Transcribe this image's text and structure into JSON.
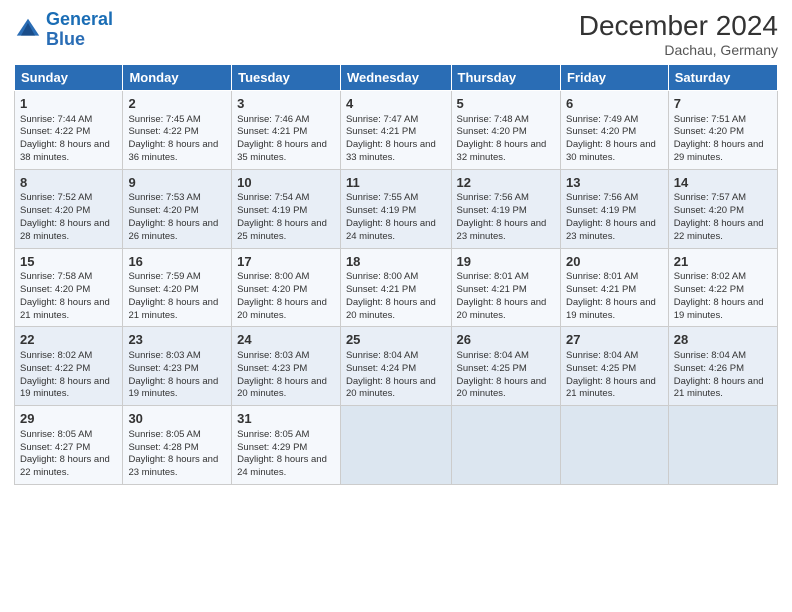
{
  "logo": {
    "line1": "General",
    "line2": "Blue"
  },
  "title": "December 2024",
  "location": "Dachau, Germany",
  "days_of_week": [
    "Sunday",
    "Monday",
    "Tuesday",
    "Wednesday",
    "Thursday",
    "Friday",
    "Saturday"
  ],
  "weeks": [
    [
      {
        "day": "1",
        "info": "Sunrise: 7:44 AM\nSunset: 4:22 PM\nDaylight: 8 hours and 38 minutes."
      },
      {
        "day": "2",
        "info": "Sunrise: 7:45 AM\nSunset: 4:22 PM\nDaylight: 8 hours and 36 minutes."
      },
      {
        "day": "3",
        "info": "Sunrise: 7:46 AM\nSunset: 4:21 PM\nDaylight: 8 hours and 35 minutes."
      },
      {
        "day": "4",
        "info": "Sunrise: 7:47 AM\nSunset: 4:21 PM\nDaylight: 8 hours and 33 minutes."
      },
      {
        "day": "5",
        "info": "Sunrise: 7:48 AM\nSunset: 4:20 PM\nDaylight: 8 hours and 32 minutes."
      },
      {
        "day": "6",
        "info": "Sunrise: 7:49 AM\nSunset: 4:20 PM\nDaylight: 8 hours and 30 minutes."
      },
      {
        "day": "7",
        "info": "Sunrise: 7:51 AM\nSunset: 4:20 PM\nDaylight: 8 hours and 29 minutes."
      }
    ],
    [
      {
        "day": "8",
        "info": "Sunrise: 7:52 AM\nSunset: 4:20 PM\nDaylight: 8 hours and 28 minutes."
      },
      {
        "day": "9",
        "info": "Sunrise: 7:53 AM\nSunset: 4:20 PM\nDaylight: 8 hours and 26 minutes."
      },
      {
        "day": "10",
        "info": "Sunrise: 7:54 AM\nSunset: 4:19 PM\nDaylight: 8 hours and 25 minutes."
      },
      {
        "day": "11",
        "info": "Sunrise: 7:55 AM\nSunset: 4:19 PM\nDaylight: 8 hours and 24 minutes."
      },
      {
        "day": "12",
        "info": "Sunrise: 7:56 AM\nSunset: 4:19 PM\nDaylight: 8 hours and 23 minutes."
      },
      {
        "day": "13",
        "info": "Sunrise: 7:56 AM\nSunset: 4:19 PM\nDaylight: 8 hours and 23 minutes."
      },
      {
        "day": "14",
        "info": "Sunrise: 7:57 AM\nSunset: 4:20 PM\nDaylight: 8 hours and 22 minutes."
      }
    ],
    [
      {
        "day": "15",
        "info": "Sunrise: 7:58 AM\nSunset: 4:20 PM\nDaylight: 8 hours and 21 minutes."
      },
      {
        "day": "16",
        "info": "Sunrise: 7:59 AM\nSunset: 4:20 PM\nDaylight: 8 hours and 21 minutes."
      },
      {
        "day": "17",
        "info": "Sunrise: 8:00 AM\nSunset: 4:20 PM\nDaylight: 8 hours and 20 minutes."
      },
      {
        "day": "18",
        "info": "Sunrise: 8:00 AM\nSunset: 4:21 PM\nDaylight: 8 hours and 20 minutes."
      },
      {
        "day": "19",
        "info": "Sunrise: 8:01 AM\nSunset: 4:21 PM\nDaylight: 8 hours and 20 minutes."
      },
      {
        "day": "20",
        "info": "Sunrise: 8:01 AM\nSunset: 4:21 PM\nDaylight: 8 hours and 19 minutes."
      },
      {
        "day": "21",
        "info": "Sunrise: 8:02 AM\nSunset: 4:22 PM\nDaylight: 8 hours and 19 minutes."
      }
    ],
    [
      {
        "day": "22",
        "info": "Sunrise: 8:02 AM\nSunset: 4:22 PM\nDaylight: 8 hours and 19 minutes."
      },
      {
        "day": "23",
        "info": "Sunrise: 8:03 AM\nSunset: 4:23 PM\nDaylight: 8 hours and 19 minutes."
      },
      {
        "day": "24",
        "info": "Sunrise: 8:03 AM\nSunset: 4:23 PM\nDaylight: 8 hours and 20 minutes."
      },
      {
        "day": "25",
        "info": "Sunrise: 8:04 AM\nSunset: 4:24 PM\nDaylight: 8 hours and 20 minutes."
      },
      {
        "day": "26",
        "info": "Sunrise: 8:04 AM\nSunset: 4:25 PM\nDaylight: 8 hours and 20 minutes."
      },
      {
        "day": "27",
        "info": "Sunrise: 8:04 AM\nSunset: 4:25 PM\nDaylight: 8 hours and 21 minutes."
      },
      {
        "day": "28",
        "info": "Sunrise: 8:04 AM\nSunset: 4:26 PM\nDaylight: 8 hours and 21 minutes."
      }
    ],
    [
      {
        "day": "29",
        "info": "Sunrise: 8:05 AM\nSunset: 4:27 PM\nDaylight: 8 hours and 22 minutes."
      },
      {
        "day": "30",
        "info": "Sunrise: 8:05 AM\nSunset: 4:28 PM\nDaylight: 8 hours and 23 minutes."
      },
      {
        "day": "31",
        "info": "Sunrise: 8:05 AM\nSunset: 4:29 PM\nDaylight: 8 hours and 24 minutes."
      },
      null,
      null,
      null,
      null
    ]
  ]
}
